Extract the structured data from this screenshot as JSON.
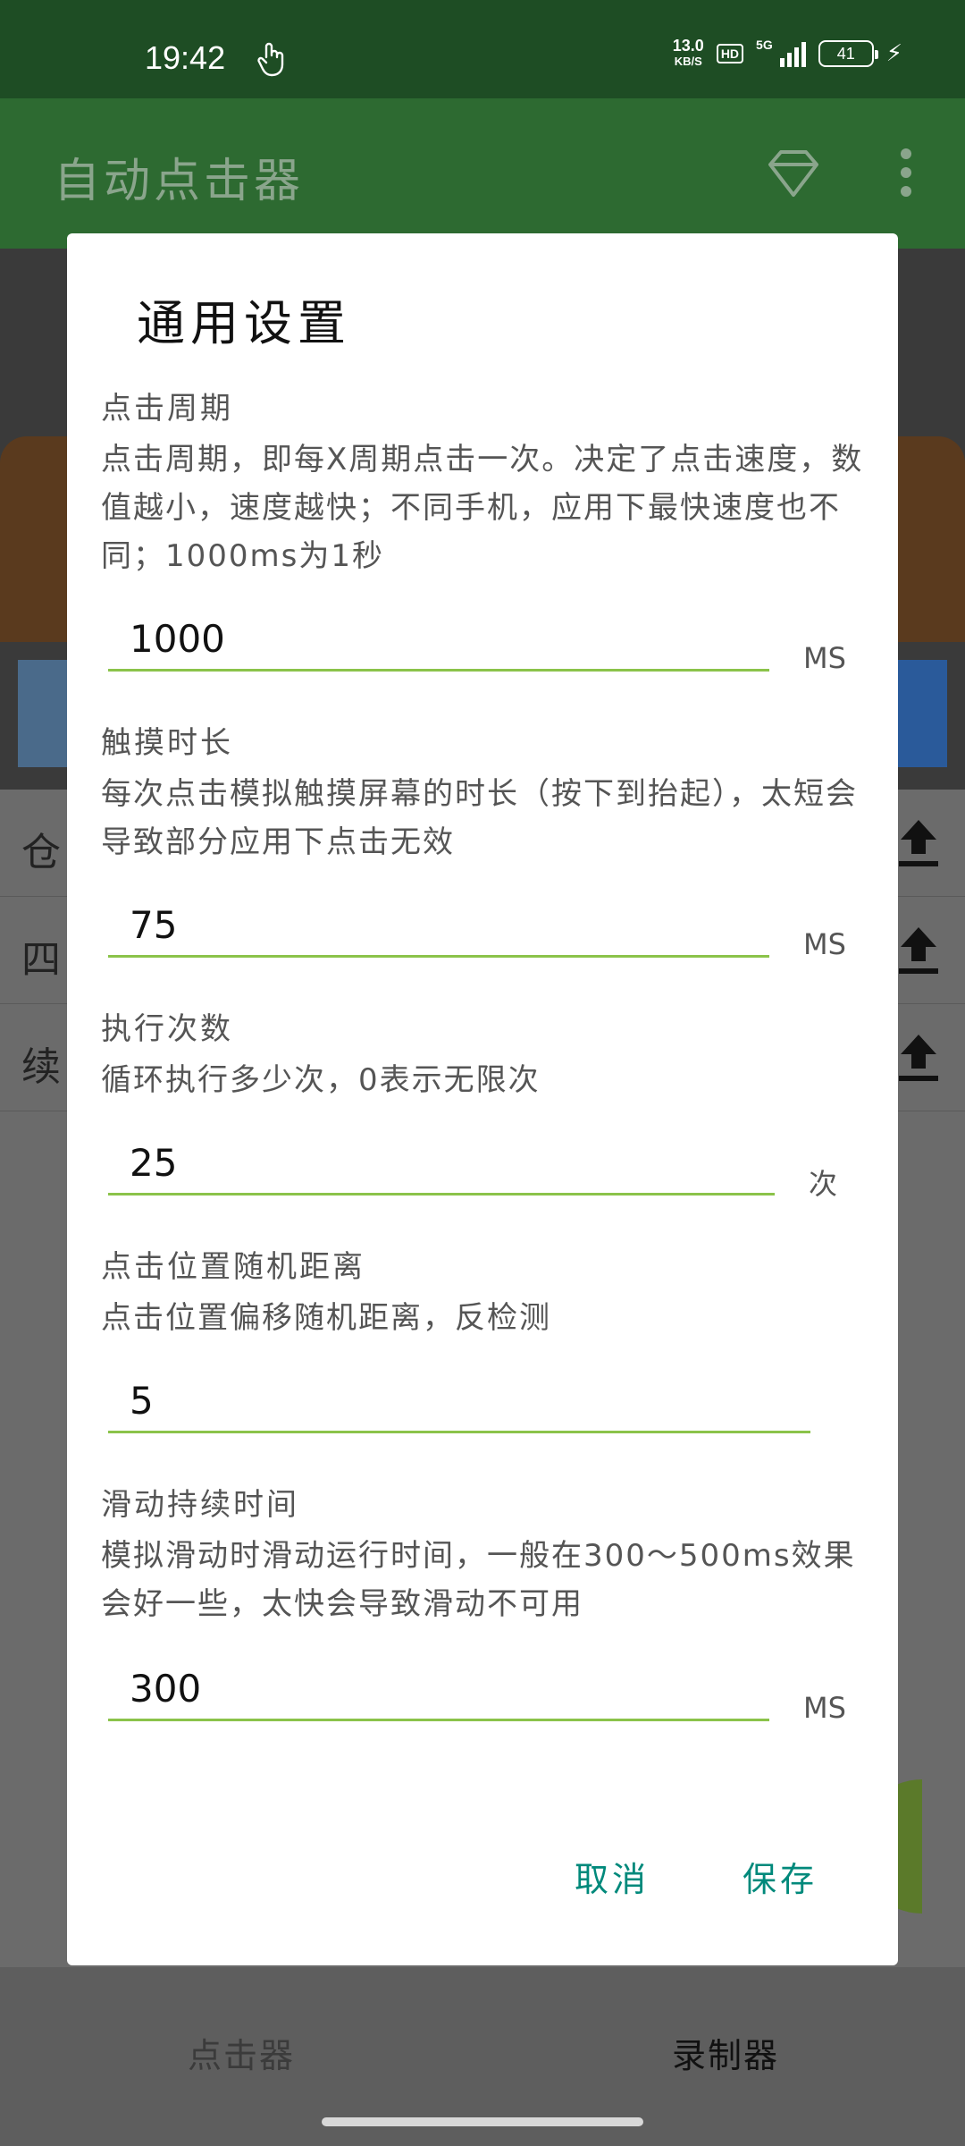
{
  "status_bar": {
    "time": "19:42",
    "net_speed_value": "13.0",
    "net_speed_unit": "KB/S",
    "hd": "HD",
    "network": "5G",
    "battery": "41"
  },
  "app_bar": {
    "title": "自动点击器",
    "icons": [
      "diamond-icon",
      "more-vert-icon"
    ]
  },
  "background": {
    "list_rows": [
      {
        "label": "仓"
      },
      {
        "label": "四"
      },
      {
        "label": "续"
      }
    ],
    "bottom_nav": {
      "clicker": "点击器",
      "recorder": "录制器"
    }
  },
  "dialog": {
    "title": "通用设置",
    "settings": [
      {
        "label": "点击周期",
        "description": "点击周期，即每X周期点击一次。决定了点击速度，数值越小，速度越快；不同手机，应用下最快速度也不同；1000ms为1秒",
        "value": "1000",
        "unit": "MS"
      },
      {
        "label": "触摸时长",
        "description": "每次点击模拟触摸屏幕的时长（按下到抬起），太短会导致部分应用下点击无效",
        "value": "75",
        "unit": "MS"
      },
      {
        "label": "执行次数",
        "description": "循环执行多少次，0表示无限次",
        "value": "25",
        "unit": "次"
      },
      {
        "label": "点击位置随机距离",
        "description": "点击位置偏移随机距离，反检测",
        "value": "5",
        "unit": ""
      },
      {
        "label": "滑动持续时间",
        "description": "模拟滑动时滑动运行时间，一般在300～500ms效果会好一些，太快会导致滑动不可用",
        "value": "300",
        "unit": "MS"
      }
    ],
    "cancel_label": "取消",
    "save_label": "保存"
  }
}
